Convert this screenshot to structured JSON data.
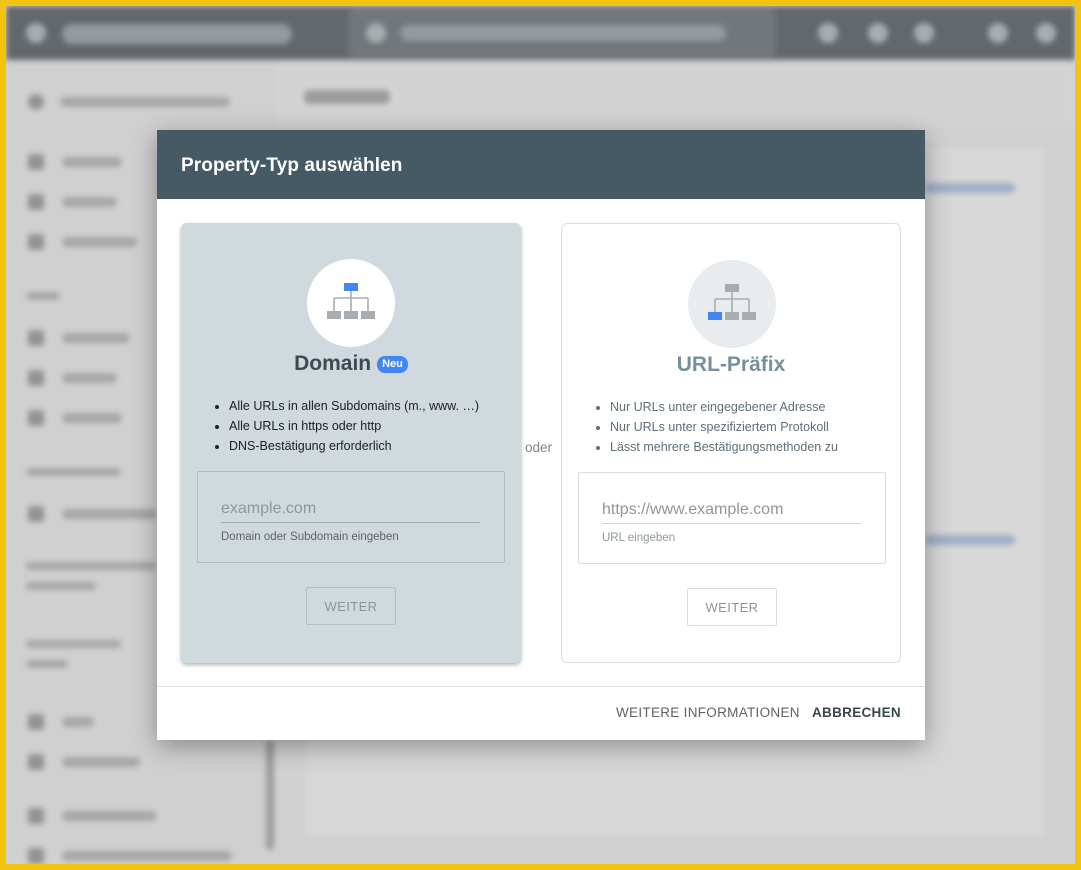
{
  "dialog": {
    "title": "Property-Typ auswählen",
    "separator": "oder",
    "footer": {
      "more_info_label": "WEITERE INFORMATIONEN",
      "cancel_label": "ABBRECHEN"
    }
  },
  "domain_option": {
    "title": "Domain",
    "badge": "Neu",
    "features": [
      "Alle URLs in allen Subdomains (m., www. …)",
      "Alle URLs in https oder http",
      "DNS-Bestätigung erforderlich"
    ],
    "input_placeholder": "example.com",
    "input_value": "",
    "helper": "Domain oder Subdomain eingeben",
    "continue_label": "WEITER",
    "icon": "sitemap-icon",
    "selected": true
  },
  "url_prefix_option": {
    "title": "URL-Präfix",
    "features": [
      "Nur URLs unter eingegebener Adresse",
      "Nur URLs unter spezifiziertem Protokoll",
      "Lässt mehrere Bestätigungsmethoden zu"
    ],
    "input_placeholder": "https://www.example.com",
    "input_value": "",
    "helper": "URL eingeben",
    "continue_label": "WEITER",
    "icon": "sitemap-icon",
    "selected": false
  },
  "colors": {
    "header": "#455a64",
    "accent": "#4285f4",
    "selected_panel": "#d0d9de",
    "frame": "#f1c40f"
  }
}
